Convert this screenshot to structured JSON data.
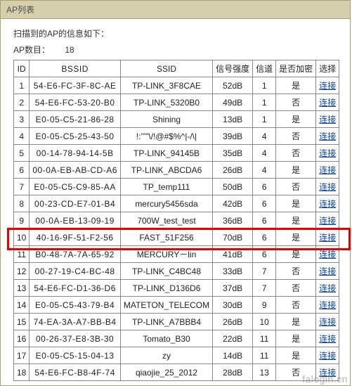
{
  "panel": {
    "title": "AP列表",
    "scan_info": "扫描到的AP的信息如下：",
    "count_label": "AP数目：",
    "count_value": "18"
  },
  "headers": {
    "id": "ID",
    "bssid": "BSSID",
    "ssid": "SSID",
    "signal": "信号强度",
    "channel": "信道",
    "encrypted": "是否加密",
    "select": "选择"
  },
  "link_label": "连接",
  "highlight_row_index": 9,
  "rows": [
    {
      "id": "1",
      "bssid": "54-E6-FC-3F-8C-AE",
      "ssid": "TP-LINK_3F8CAE",
      "signal": "52dB",
      "channel": "1",
      "encrypted": "是"
    },
    {
      "id": "2",
      "bssid": "54-E6-FC-53-20-B0",
      "ssid": "TP-LINK_5320B0",
      "signal": "49dB",
      "channel": "1",
      "encrypted": "否"
    },
    {
      "id": "3",
      "bssid": "E0-05-C5-21-86-28",
      "ssid": "Shining",
      "signal": "13dB",
      "channel": "1",
      "encrypted": "是"
    },
    {
      "id": "4",
      "bssid": "E0-05-C5-25-43-50",
      "ssid": "!:'\"\"\\/!@#$%^|-/\\|",
      "signal": "39dB",
      "channel": "4",
      "encrypted": "否"
    },
    {
      "id": "5",
      "bssid": "00-14-78-94-14-5B",
      "ssid": "TP-LINK_94145B",
      "signal": "35dB",
      "channel": "4",
      "encrypted": "否"
    },
    {
      "id": "6",
      "bssid": "00-0A-EB-AB-CD-A6",
      "ssid": "TP-LINK_ABCDA6",
      "signal": "26dB",
      "channel": "4",
      "encrypted": "是"
    },
    {
      "id": "7",
      "bssid": "E0-05-C5-C9-85-AA",
      "ssid": "TP_temp111",
      "signal": "50dB",
      "channel": "6",
      "encrypted": "否"
    },
    {
      "id": "8",
      "bssid": "00-23-CD-E7-01-B4",
      "ssid": "mercury5456sda",
      "signal": "42dB",
      "channel": "6",
      "encrypted": "是"
    },
    {
      "id": "9",
      "bssid": "00-0A-EB-13-09-19",
      "ssid": "700W_test_test",
      "signal": "36dB",
      "channel": "6",
      "encrypted": "是"
    },
    {
      "id": "10",
      "bssid": "40-16-9F-51-F2-56",
      "ssid": "FAST_51F256",
      "signal": "70dB",
      "channel": "6",
      "encrypted": "是"
    },
    {
      "id": "11",
      "bssid": "B0-48-7A-7A-65-92",
      "ssid": "MERCURY－lin",
      "signal": "41dB",
      "channel": "6",
      "encrypted": "是"
    },
    {
      "id": "12",
      "bssid": "00-27-19-C4-BC-48",
      "ssid": "TP-LINK_C4BC48",
      "signal": "33dB",
      "channel": "7",
      "encrypted": "否"
    },
    {
      "id": "13",
      "bssid": "54-E6-FC-D1-36-D6",
      "ssid": "TP-LINK_D136D6",
      "signal": "37dB",
      "channel": "7",
      "encrypted": "否"
    },
    {
      "id": "14",
      "bssid": "E0-05-C5-43-79-B4",
      "ssid": "MATETON_TELECOM",
      "signal": "30dB",
      "channel": "9",
      "encrypted": "否"
    },
    {
      "id": "15",
      "bssid": "74-EA-3A-A7-BB-B4",
      "ssid": "TP-LINK_A7BBB4",
      "signal": "26dB",
      "channel": "10",
      "encrypted": "是"
    },
    {
      "id": "16",
      "bssid": "00-26-37-E8-3B-30",
      "ssid": "Tomato_B30",
      "signal": "22dB",
      "channel": "11",
      "encrypted": "是"
    },
    {
      "id": "17",
      "bssid": "E0-05-C5-15-04-13",
      "ssid": "zy",
      "signal": "14dB",
      "channel": "11",
      "encrypted": "是"
    },
    {
      "id": "18",
      "bssid": "54-E6-FC-B8-4F-74",
      "ssid": "qiaojie_25_2012",
      "signal": "28dB",
      "channel": "13",
      "encrypted": "否"
    }
  ],
  "watermark": "falogin.cn"
}
